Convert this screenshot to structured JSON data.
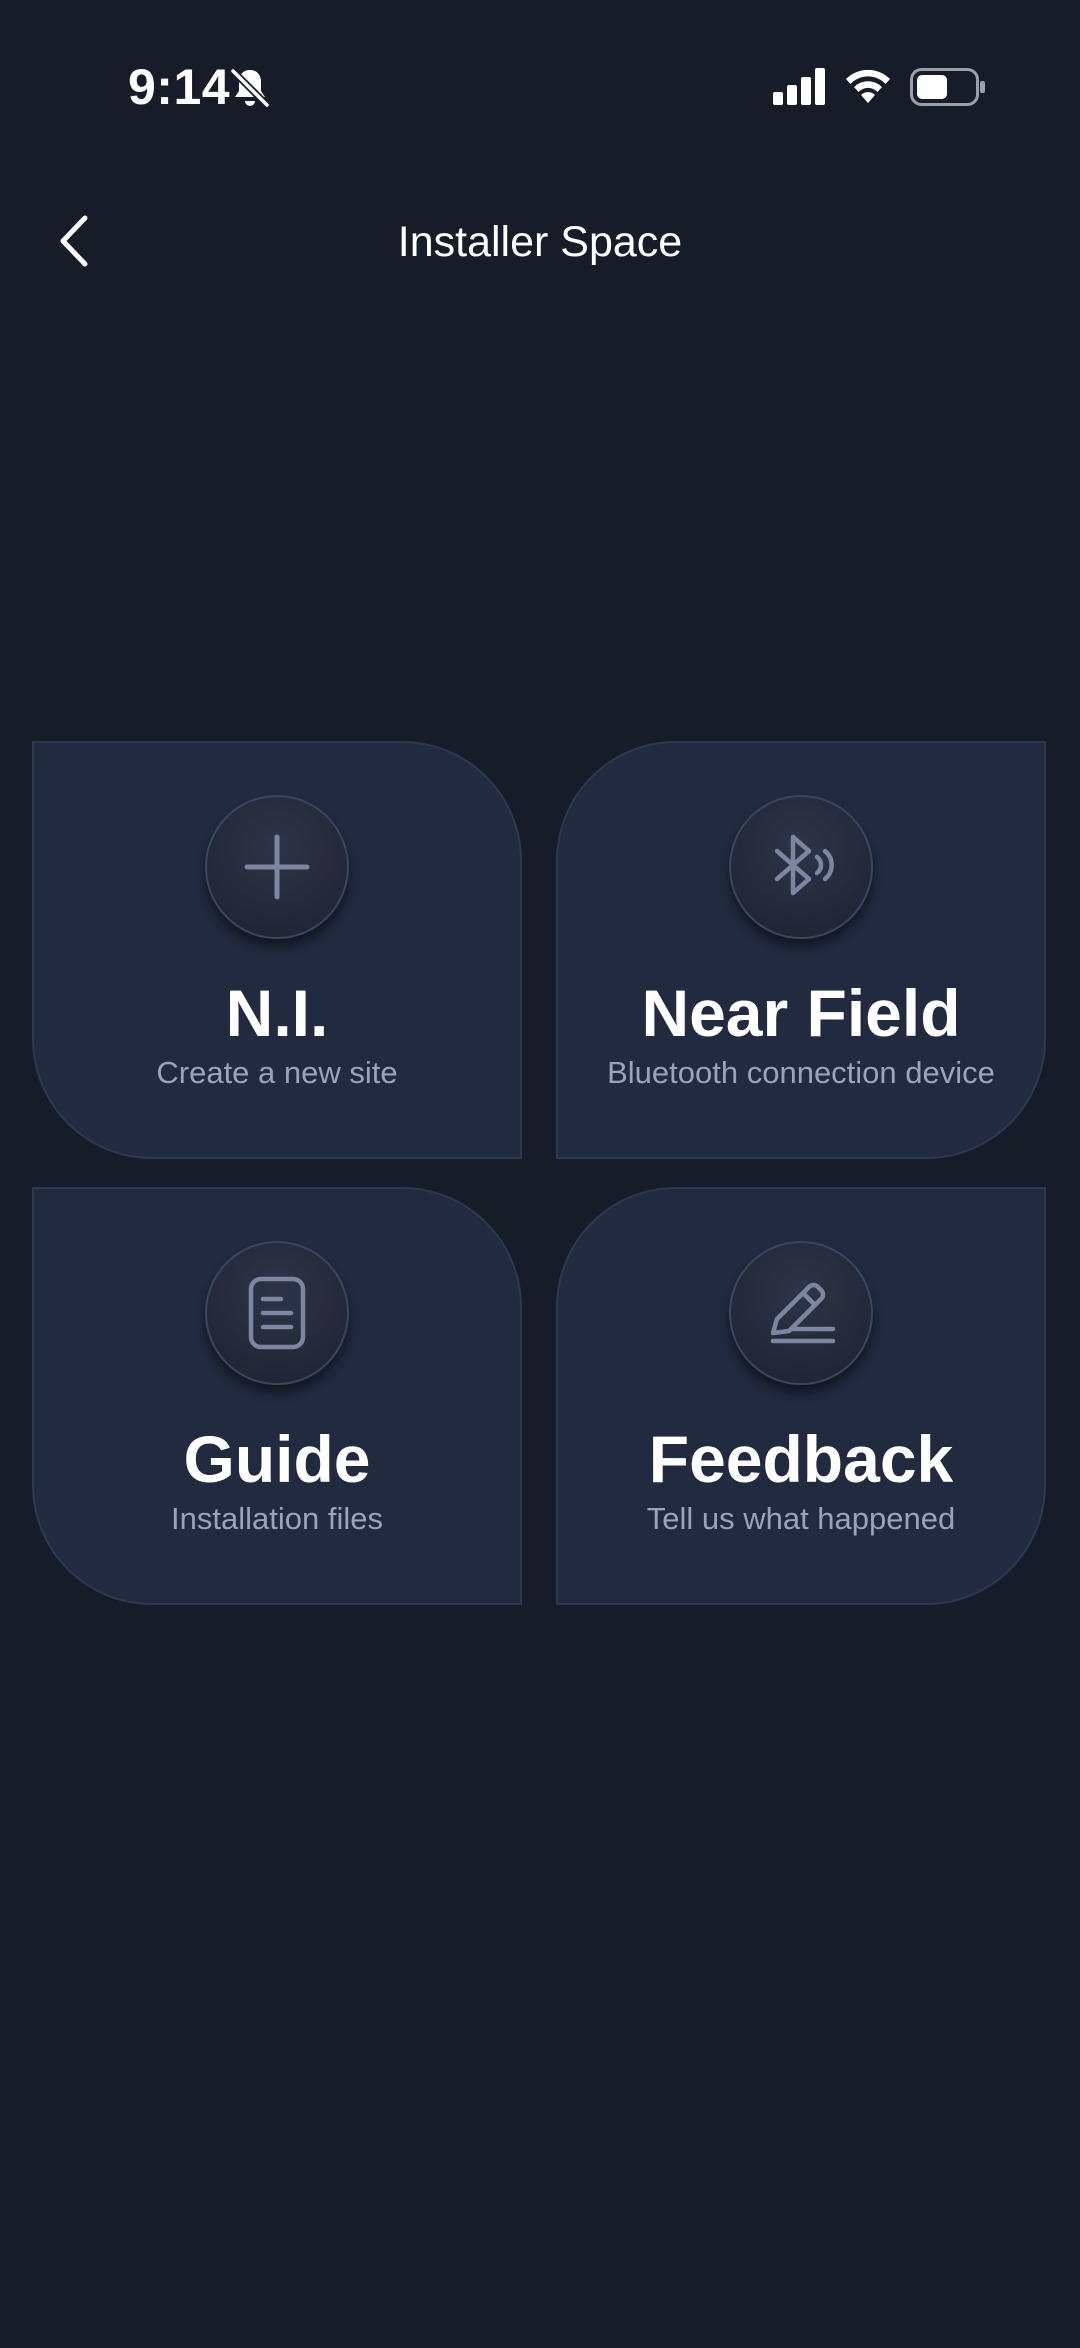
{
  "status_bar": {
    "time": "9:14"
  },
  "header": {
    "title": "Installer Space"
  },
  "cards": [
    {
      "title": "N.I.",
      "subtitle": "Create a new site",
      "icon": "plus-icon"
    },
    {
      "title": "Near Field",
      "subtitle": "Bluetooth connection device",
      "icon": "bluetooth-icon"
    },
    {
      "title": "Guide",
      "subtitle": "Installation files",
      "icon": "document-icon"
    },
    {
      "title": "Feedback",
      "subtitle": "Tell us what happened",
      "icon": "pencil-icon"
    }
  ],
  "colors": {
    "background": "#161c28",
    "card": "#212a3e",
    "icon_stroke": "#7c86a0",
    "subtitle": "#9aa3b8"
  }
}
